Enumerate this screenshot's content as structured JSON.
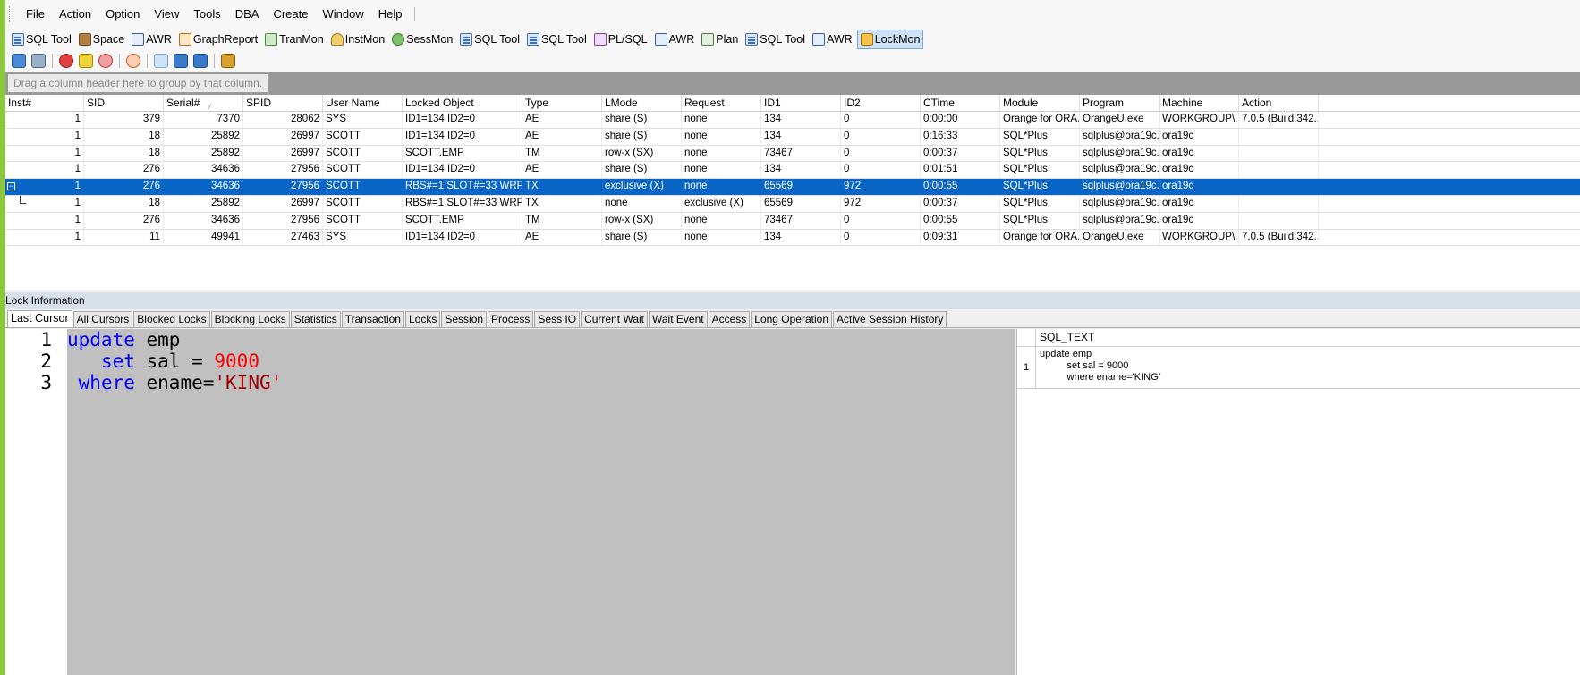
{
  "menu": [
    "File",
    "Action",
    "Option",
    "View",
    "Tools",
    "DBA",
    "Create",
    "Window",
    "Help"
  ],
  "toolbar": [
    {
      "label": "SQL Tool",
      "icon": "sql-icon"
    },
    {
      "label": "Space",
      "icon": "space-icon"
    },
    {
      "label": "AWR",
      "icon": "awr-icon"
    },
    {
      "label": "GraphReport",
      "icon": "graph-icon"
    },
    {
      "label": "TranMon",
      "icon": "tranmon-icon"
    },
    {
      "label": "InstMon",
      "icon": "instmon-icon"
    },
    {
      "label": "SessMon",
      "icon": "sessmon-icon"
    },
    {
      "label": "SQL Tool",
      "icon": "sql-icon"
    },
    {
      "label": "SQL Tool",
      "icon": "sql-icon"
    },
    {
      "label": "PL/SQL",
      "icon": "plsql-icon"
    },
    {
      "label": "AWR",
      "icon": "awr-icon"
    },
    {
      "label": "Plan",
      "icon": "plan-icon"
    },
    {
      "label": "SQL Tool",
      "icon": "sql-icon"
    },
    {
      "label": "AWR",
      "icon": "awr-icon"
    },
    {
      "label": "LockMon",
      "icon": "lockmon-icon",
      "active": true
    }
  ],
  "grid": {
    "group_hint": "Drag a column header here to group by that column.",
    "columns": [
      "Inst#",
      "SID",
      "Serial#",
      "SPID",
      "User Name",
      "Locked Object",
      "Type",
      "LMode",
      "Request",
      "ID1",
      "ID2",
      "CTime",
      "Module",
      "Program",
      "Machine",
      "Action"
    ],
    "rows": [
      [
        "1",
        "379",
        "7370",
        "28062",
        "SYS",
        "ID1=134 ID2=0",
        "AE",
        "share (S)",
        "none",
        "134",
        "0",
        "0:00:00",
        "Orange for ORA...",
        "OrangeU.exe",
        "WORKGROUP\\...",
        "7.0.5 (Build:342..."
      ],
      [
        "1",
        "18",
        "25892",
        "26997",
        "SCOTT",
        "ID1=134 ID2=0",
        "AE",
        "share (S)",
        "none",
        "134",
        "0",
        "0:16:33",
        "SQL*Plus",
        "sqlplus@ora19c...",
        "ora19c",
        ""
      ],
      [
        "1",
        "18",
        "25892",
        "26997",
        "SCOTT",
        "SCOTT.EMP",
        "TM",
        "row-x (SX)",
        "none",
        "73467",
        "0",
        "0:00:37",
        "SQL*Plus",
        "sqlplus@ora19c...",
        "ora19c",
        ""
      ],
      [
        "1",
        "276",
        "34636",
        "27956",
        "SCOTT",
        "ID1=134 ID2=0",
        "AE",
        "share (S)",
        "none",
        "134",
        "0",
        "0:01:51",
        "SQL*Plus",
        "sqlplus@ora19c...",
        "ora19c",
        ""
      ],
      [
        "1",
        "276",
        "34636",
        "27956",
        "SCOTT",
        "RBS#=1 SLOT#=33 WRP...",
        "TX",
        "exclusive (X)",
        "none",
        "65569",
        "972",
        "0:00:55",
        "SQL*Plus",
        "sqlplus@ora19c...",
        "ora19c",
        ""
      ],
      [
        "1",
        "18",
        "25892",
        "26997",
        "SCOTT",
        "RBS#=1 SLOT#=33 WRP...",
        "TX",
        "none",
        "exclusive (X)",
        "65569",
        "972",
        "0:00:37",
        "SQL*Plus",
        "sqlplus@ora19c...",
        "ora19c",
        ""
      ],
      [
        "1",
        "276",
        "34636",
        "27956",
        "SCOTT",
        "SCOTT.EMP",
        "TM",
        "row-x (SX)",
        "none",
        "73467",
        "0",
        "0:00:55",
        "SQL*Plus",
        "sqlplus@ora19c...",
        "ora19c",
        ""
      ],
      [
        "1",
        "11",
        "49941",
        "27463",
        "SYS",
        "ID1=134 ID2=0",
        "AE",
        "share (S)",
        "none",
        "134",
        "0",
        "0:09:31",
        "Orange for ORA...",
        "OrangeU.exe",
        "WORKGROUP\\...",
        "7.0.5 (Build:342..."
      ]
    ]
  },
  "lock_info_title": "Lock Information",
  "tabs": [
    "Last Cursor",
    "All Cursors",
    "Blocked Locks",
    "Blocking Locks",
    "Statistics",
    "Transaction",
    "Locks",
    "Session",
    "Process",
    "Sess IO",
    "Current Wait",
    "Wait Event",
    "Access",
    "Long Operation",
    "Active Session History"
  ],
  "editor": {
    "line_numbers": [
      "1",
      "2",
      "3"
    ],
    "line1": {
      "kw": "update",
      "rest": " emp"
    },
    "line2": {
      "indent": "   ",
      "kw": "set",
      "rest": " sal = ",
      "num": "9000"
    },
    "line3": {
      "indent": " ",
      "kw": "where",
      "rest": " ename=",
      "str": "'KING'"
    }
  },
  "sql_text": {
    "header": "SQL_TEXT",
    "row_num": "1",
    "text": "update emp\n          set sal = 9000\n          where ename='KING'"
  }
}
